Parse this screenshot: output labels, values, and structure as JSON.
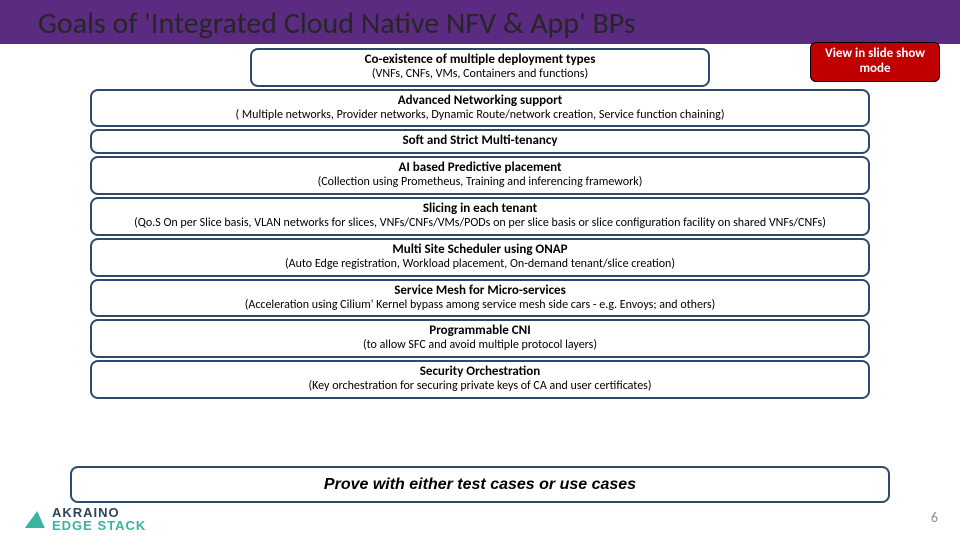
{
  "slide": {
    "title": "Goals of 'Integrated Cloud Native NFV & App' BPs",
    "view_button": "View in slide show mode",
    "page_number": "6"
  },
  "logo": {
    "line1": "AKRAINO",
    "line2": "EDGE STACK"
  },
  "goals": [
    {
      "title": "Co-existence of multiple deployment types",
      "sub": "(VNFs, CNFs, VMs, Containers and functions)",
      "cls": "co-ex"
    },
    {
      "title": "Advanced Networking support",
      "sub": "( Multiple networks,  Provider networks, Dynamic Route/network creation, Service function chaining)"
    },
    {
      "title": "Soft and Strict Multi-tenancy",
      "sub": ""
    },
    {
      "title": "AI based Predictive placement",
      "sub": "(Collection using Prometheus,  Training and inferencing framework)"
    },
    {
      "title": "Slicing in each tenant",
      "sub": "(Qo.S On per Slice basis,  VLAN networks for slices, VNFs/CNFs/VMs/PODs on per slice basis  or slice configuration facility on shared VNFs/CNFs)",
      "cls": "slicing"
    },
    {
      "title": "Multi Site Scheduler using ONAP",
      "sub": "(Auto Edge registration,  Workload placement, On-demand tenant/slice creation)"
    },
    {
      "title": "Service Mesh for Micro-services",
      "sub": "(Acceleration using Cilium'  Kernel bypass among service mesh side cars - e.g. Envoys;  and others)"
    },
    {
      "title": "Programmable CNI",
      "sub": "(to allow SFC and avoid multiple protocol layers)"
    },
    {
      "title": "Security Orchestration",
      "sub": "(Key orchestration for securing private keys of CA and user certificates)"
    }
  ],
  "prove": "Prove with either test cases or use cases"
}
